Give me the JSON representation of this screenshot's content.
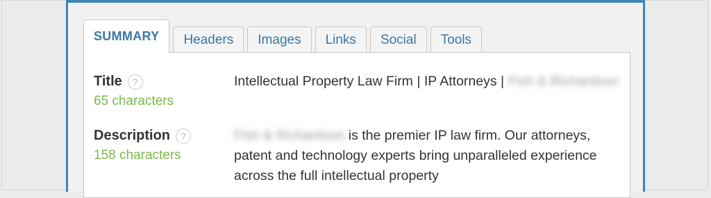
{
  "tabs": [
    {
      "label": "SUMMARY",
      "active": true
    },
    {
      "label": "Headers",
      "active": false
    },
    {
      "label": "Images",
      "active": false
    },
    {
      "label": "Links",
      "active": false
    },
    {
      "label": "Social",
      "active": false
    },
    {
      "label": "Tools",
      "active": false
    }
  ],
  "summary": {
    "title": {
      "label": "Title",
      "count": "65 characters",
      "value_text": "Intellectual Property Law Firm | IP Attorneys |",
      "value_redacted": "Fish & Richardson"
    },
    "description": {
      "label": "Description",
      "count": "158 characters",
      "value_redacted": "Fish & Richardson",
      "value_text": "is the premier IP law firm. Our attorneys, patent and technology experts bring unparalleled experience across the full intellectual property"
    },
    "help_icon_glyph": "?"
  },
  "colors": {
    "frame_accent": "#3f86b4",
    "tab_text": "#3b77a4",
    "count_text": "#79b94a"
  }
}
